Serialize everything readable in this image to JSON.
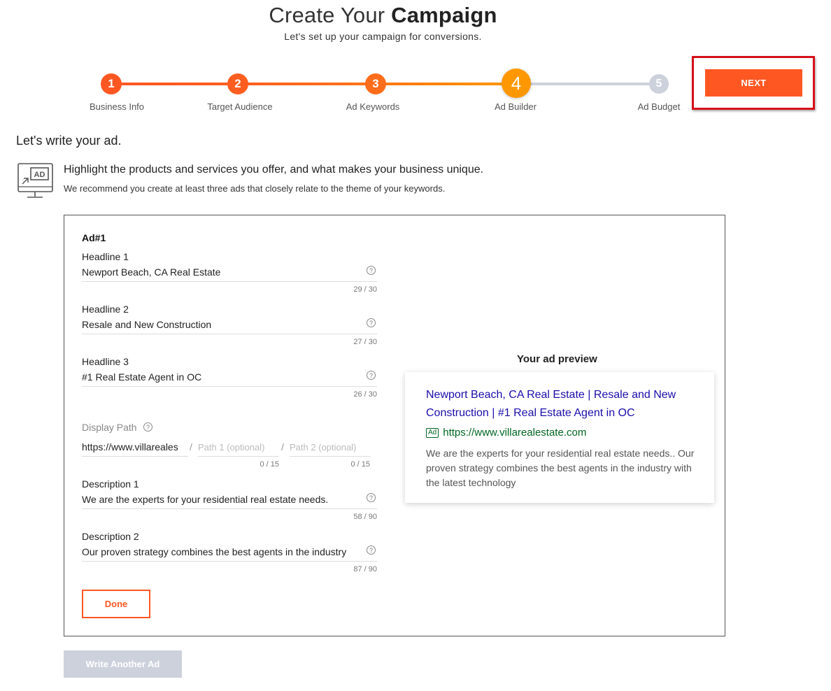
{
  "header": {
    "title_light": "Create Your",
    "title_bold": "Campaign",
    "subtitle": "Let's set up your campaign for conversions."
  },
  "steps": [
    {
      "number": "1",
      "label": "Business Info",
      "state": "complete"
    },
    {
      "number": "2",
      "label": "Target Audience",
      "state": "complete"
    },
    {
      "number": "3",
      "label": "Ad Keywords",
      "state": "complete"
    },
    {
      "number": "4",
      "label": "Ad Builder",
      "state": "current"
    },
    {
      "number": "5",
      "label": "Ad Budget",
      "state": "upcoming"
    }
  ],
  "next_label": "NEXT",
  "section_title": "Let's write your ad.",
  "intro": {
    "icon_text": "AD",
    "headline": "Highlight the products and services you offer, and what makes your business unique.",
    "sub": "We recommend you create at least three ads that closely relate to the theme of your keywords."
  },
  "ad": {
    "label": "Ad#1",
    "headline1": {
      "label": "Headline 1",
      "value": "Newport Beach, CA Real Estate",
      "count": "29 / 30"
    },
    "headline2": {
      "label": "Headline 2",
      "value": "Resale and New Construction",
      "count": "27 / 30"
    },
    "headline3": {
      "label": "Headline 3",
      "value": "#1 Real Estate Agent in OC",
      "count": "26 / 30"
    },
    "display_path": {
      "label": "Display Path",
      "domain": "https://www.villareales",
      "separator": "/",
      "path1_placeholder": "Path 1 (optional)",
      "path2_placeholder": "Path 2 (optional)",
      "path1_count": "0 / 15",
      "path2_count": "0 / 15"
    },
    "description1": {
      "label": "Description 1",
      "value": "We are the experts for your residential real estate needs.",
      "count": "58 / 90"
    },
    "description2": {
      "label": "Description 2",
      "value": "Our proven strategy combines the best agents in the industry",
      "count": "87 / 90"
    },
    "done_label": "Done",
    "help_glyph": "?"
  },
  "preview": {
    "title": "Your ad preview",
    "headline": "Newport Beach, CA Real Estate | Resale and New Construction | #1 Real Estate Agent in OC",
    "badge": "Ad",
    "url": "https://www.villarealestate.com",
    "description": "We are the experts for your residential real estate needs.. Our proven strategy combines the best agents in the industry with the latest technology"
  },
  "write_another_label": "Write Another Ad",
  "colors": {
    "accent": "#ff5722",
    "current_step": "#ff9800",
    "upcoming": "#ccd1dc",
    "highlight": "#d6101a",
    "link": "#1a0dab",
    "url_green": "#006621"
  }
}
